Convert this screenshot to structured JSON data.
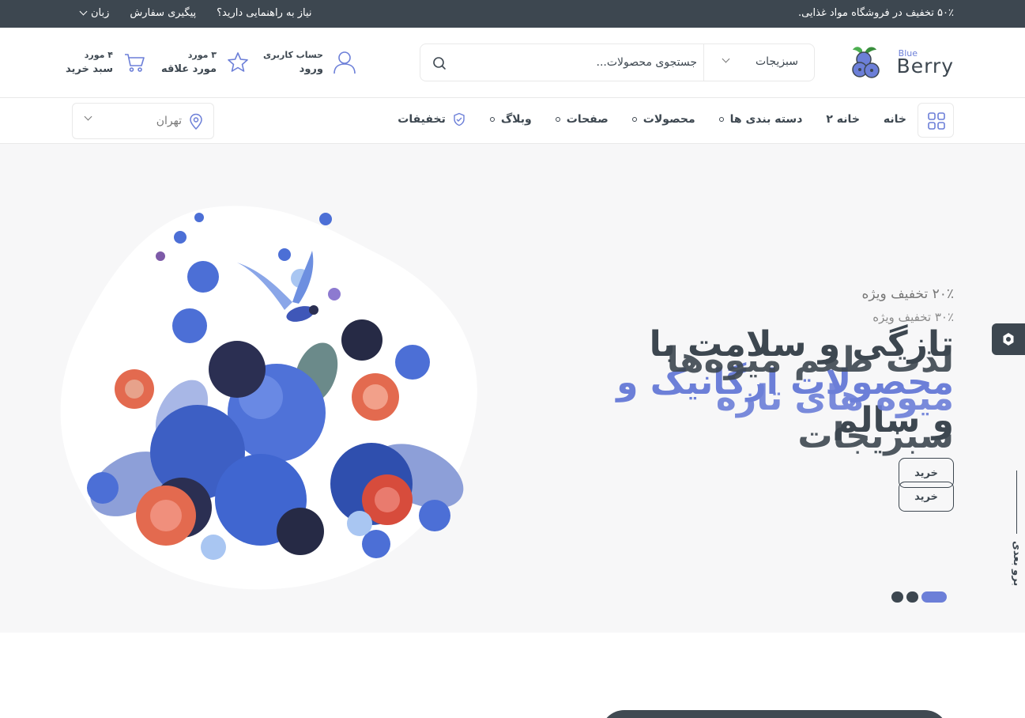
{
  "topbar": {
    "promo": "۵۰٪ تخفیف در فروشگاه مواد غذایی.",
    "help": "نیاز به راهنمایی دارید؟",
    "track": "پیگیری سفارش",
    "language": "زبان"
  },
  "logo": {
    "small": "Blue",
    "big": "Berry"
  },
  "search": {
    "category": "سبزیجات",
    "placeholder": "جستجوی محصولات..."
  },
  "header_items": {
    "account_small": "حساب کاربری",
    "account_big": "ورود",
    "wishlist_small": "۳ مورد",
    "wishlist_big": "مورد علاقه",
    "cart_small": "۴ مورد",
    "cart_big": "سبد خرید"
  },
  "nav": {
    "items": [
      "خانه",
      "خانه ۲",
      "دسته بندی ها",
      "محصولات",
      "صفحات",
      "وبلاگ",
      "تخفیفات"
    ],
    "location": "تهران"
  },
  "hero": {
    "sub1": "۲۰٪ تخفیف ویژه",
    "sub2": "۳۰٪ تخفیف ویژه",
    "title1_a": "تازگی و سلامت با",
    "title1_b": "محصولات ارگانیک و",
    "title1_c": "و سالم",
    "title2_a": "لذت طعم میوه‌ها",
    "title2_b": "میوه های تازه",
    "title2_c": "سبزیجات",
    "buy1": "خرید",
    "buy2": "خرید",
    "next": "برو بعدی"
  },
  "colors": {
    "dark": "#3d4750",
    "accent": "#6c7fd8"
  }
}
